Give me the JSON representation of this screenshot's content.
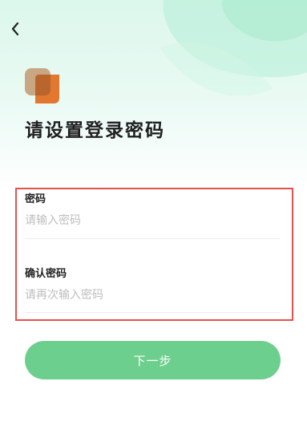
{
  "header": {
    "back_icon": "chevron-left-icon"
  },
  "logo": {
    "icon": "app-logo-icon",
    "colors": {
      "back": "#c9a784",
      "front": "#e2772f"
    }
  },
  "page": {
    "title": "请设置登录密码"
  },
  "form": {
    "password": {
      "label": "密码",
      "placeholder": "请输入密码",
      "value": ""
    },
    "confirm_password": {
      "label": "确认密码",
      "placeholder": "请再次输入密码",
      "value": ""
    }
  },
  "actions": {
    "next_label": "下一步"
  },
  "colors": {
    "accent": "#6ccf8d",
    "highlight_border": "#e4514f",
    "placeholder": "#bdbdbd",
    "background_tint": "#dcf7ec"
  }
}
